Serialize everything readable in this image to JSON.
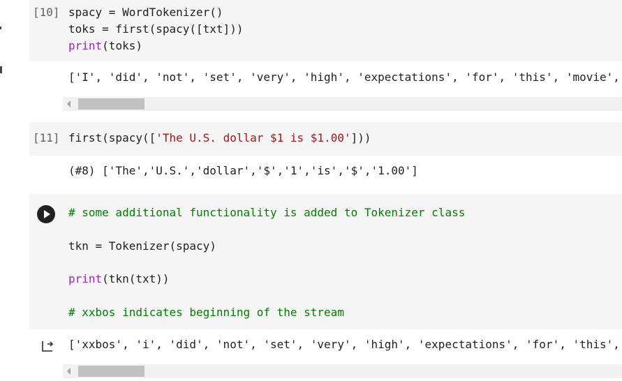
{
  "cells": [
    {
      "number": "[10]",
      "code_lines": [
        {
          "parts": [
            {
              "t": "spacy = WordTokenizer()",
              "c": ""
            }
          ]
        },
        {
          "parts": [
            {
              "t": "toks = first(spacy([txt]))",
              "c": ""
            }
          ]
        },
        {
          "parts": [
            {
              "t": "print",
              "c": "kw"
            },
            {
              "t": "(toks)",
              "c": ""
            }
          ]
        }
      ],
      "output": "['I', 'did', 'not', 'set', 'very', 'high', 'expectations', 'for', 'this', 'movie',"
    },
    {
      "number": "[11]",
      "code_lines": [
        {
          "parts": [
            {
              "t": "first(spacy([",
              "c": ""
            },
            {
              "t": "'The U.S. dollar $1 is $1.00'",
              "c": "str"
            },
            {
              "t": "]))",
              "c": ""
            }
          ]
        }
      ],
      "output": "(#8) ['The','U.S.','dollar','$','1','is','$','1.00']"
    },
    {
      "code_lines": [
        {
          "parts": [
            {
              "t": "# some additional functionality is added to Tokenizer class",
              "c": "com"
            }
          ]
        },
        {
          "parts": [
            {
              "t": "tkn = Tokenizer(spacy)",
              "c": ""
            }
          ]
        },
        {
          "parts": [
            {
              "t": "print",
              "c": "kw"
            },
            {
              "t": "(tkn(txt))",
              "c": ""
            }
          ]
        },
        {
          "parts": [
            {
              "t": "# xxbos indicates beginning of the stream",
              "c": "com"
            }
          ]
        }
      ],
      "output": "['xxbos', 'i', 'did', 'not', 'set', 'very', 'high', 'expectations', 'for', 'this',"
    }
  ],
  "icons": {
    "run": "play-icon",
    "output_action": "output-redirect-icon",
    "scroll_left": "chevron-left-icon"
  }
}
